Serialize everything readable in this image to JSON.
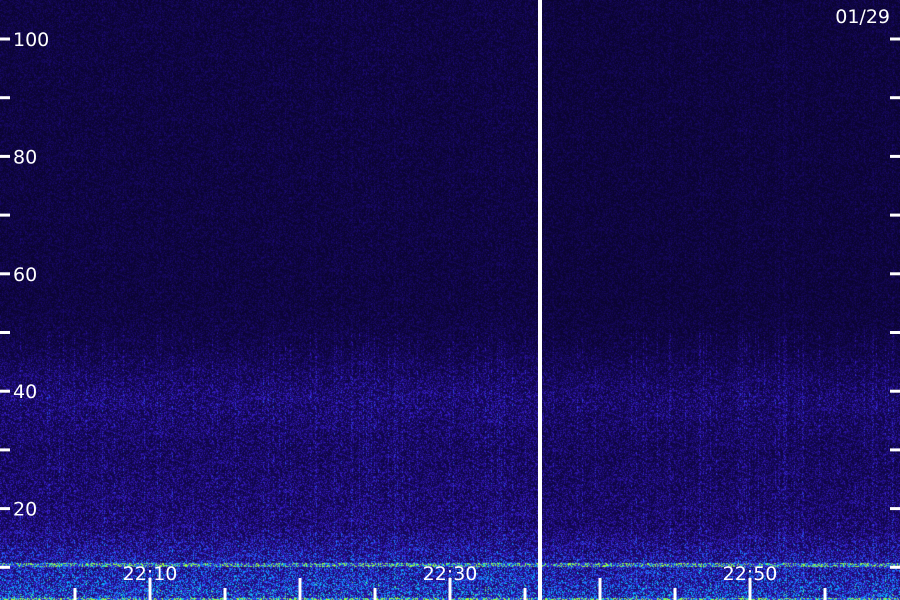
{
  "chart_data": {
    "type": "heatmap",
    "date_label": "01/29",
    "y_axis": {
      "min": 0,
      "max": 100,
      "major_ticks": [
        20,
        40,
        60,
        80,
        100
      ],
      "minor_ticks": [
        10,
        30,
        50,
        70,
        90
      ]
    },
    "x_axis": {
      "start": "22:00",
      "end": "22:60",
      "labeled_ticks": [
        {
          "minute": 10,
          "label": "22:10"
        },
        {
          "minute": 30,
          "label": "22:30"
        },
        {
          "minute": 50,
          "label": "22:50"
        }
      ],
      "minor_tick_step_minutes": 5
    },
    "marker_minute": 36,
    "colormap": [
      "#06021e",
      "#1a0a6e",
      "#3a1fd0",
      "#1e6cff",
      "#00c8ff",
      "#9dff3a"
    ],
    "features": {
      "low_band_upper": 17,
      "enhanced_band": [
        30,
        48
      ],
      "strong_lines": [
        4.5,
        10.5
      ]
    }
  }
}
